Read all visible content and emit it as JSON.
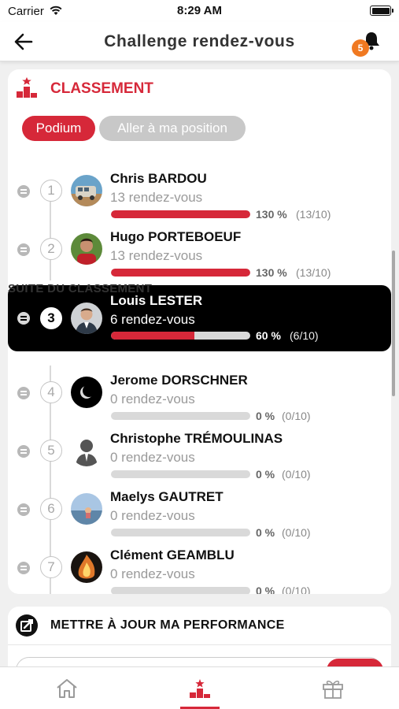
{
  "status_bar": {
    "carrier": "Carrier",
    "time": "8:29 AM"
  },
  "navbar": {
    "title": "Challenge rendez-vous",
    "notification_count": "5"
  },
  "colors": {
    "accent": "#d62839",
    "badge": "#f07921",
    "current_row_bg": "#000000"
  },
  "ranking": {
    "title": "CLASSEMENT",
    "tabs": {
      "podium": "Podium",
      "go_to_position": "Aller à ma position"
    },
    "suite_label": "SUITE DU CLASSEMENT",
    "entries": [
      {
        "rank": "1",
        "name": "Chris BARDOU",
        "meetings": "13 rendez-vous",
        "progress": 1.0,
        "percent": "130 %",
        "fraction": "(13/10)",
        "avatar": "van-photo"
      },
      {
        "rank": "2",
        "name": "Hugo PORTEBOEUF",
        "meetings": "13 rendez-vous",
        "progress": 1.0,
        "percent": "130 %",
        "fraction": "(13/10)",
        "avatar": "man-photo"
      },
      {
        "rank": "3",
        "name": "Louis LESTER",
        "meetings": "6 rendez-vous",
        "progress": 0.6,
        "percent": "60 %",
        "fraction": "(6/10)",
        "avatar": "man-suit-photo",
        "current": true
      },
      {
        "rank": "4",
        "name": "Jerome DORSCHNER",
        "meetings": "0 rendez-vous",
        "progress": 0,
        "percent": "0 %",
        "fraction": "(0/10)",
        "avatar": "eclipse-photo"
      },
      {
        "rank": "5",
        "name": "Christophe TRÉMOULINAS",
        "meetings": "0 rendez-vous",
        "progress": 0,
        "percent": "0 %",
        "fraction": "(0/10)",
        "avatar": "silhouette-icon"
      },
      {
        "rank": "6",
        "name": "Maelys GAUTRET",
        "meetings": "0 rendez-vous",
        "progress": 0,
        "percent": "0 %",
        "fraction": "(0/10)",
        "avatar": "beach-photo"
      },
      {
        "rank": "7",
        "name": "Clément GEAMBLU",
        "meetings": "0 rendez-vous",
        "progress": 0,
        "percent": "0 %",
        "fraction": "(0/10)",
        "avatar": "fire-photo"
      }
    ]
  },
  "performance": {
    "title": "METTRE À JOUR MA PERFORMANCE"
  },
  "tabbar": {
    "items": [
      "home-icon",
      "podium-icon",
      "gift-icon"
    ],
    "active": "podium-icon"
  }
}
